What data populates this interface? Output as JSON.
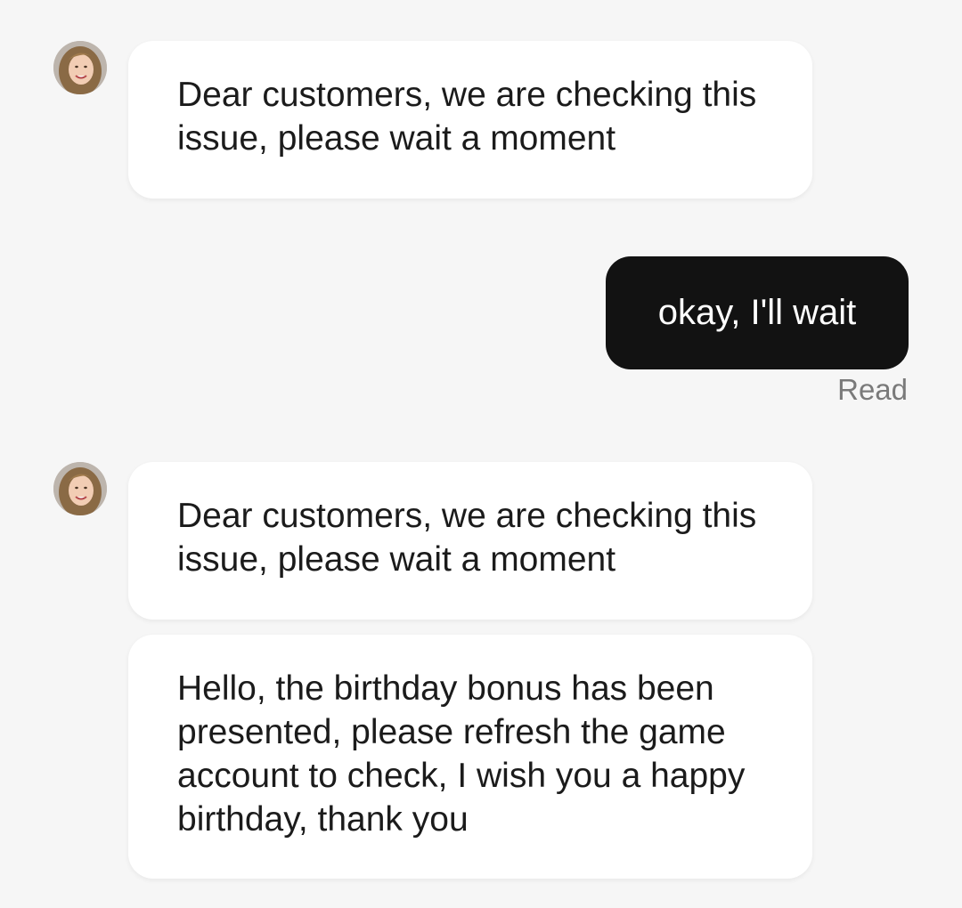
{
  "messages": [
    {
      "direction": "incoming",
      "text": "Dear customers, we are checking this issue, please wait a moment",
      "avatar": "agent-avatar"
    },
    {
      "direction": "outgoing",
      "text": "okay, I'll wait",
      "status": "Read"
    },
    {
      "direction": "incoming",
      "text": "Dear customers, we are checking this issue, please wait a moment",
      "avatar": "agent-avatar"
    },
    {
      "direction": "incoming",
      "text": "Hello, the birthday bonus has been presented, please refresh the game account to check, I wish you a happy birthday, thank you"
    }
  ],
  "colors": {
    "background": "#f6f6f6",
    "incoming_bubble": "#ffffff",
    "outgoing_bubble": "#121212",
    "incoming_text": "#1b1b1b",
    "outgoing_text": "#ffffff",
    "status_text": "#7a7a7a"
  }
}
